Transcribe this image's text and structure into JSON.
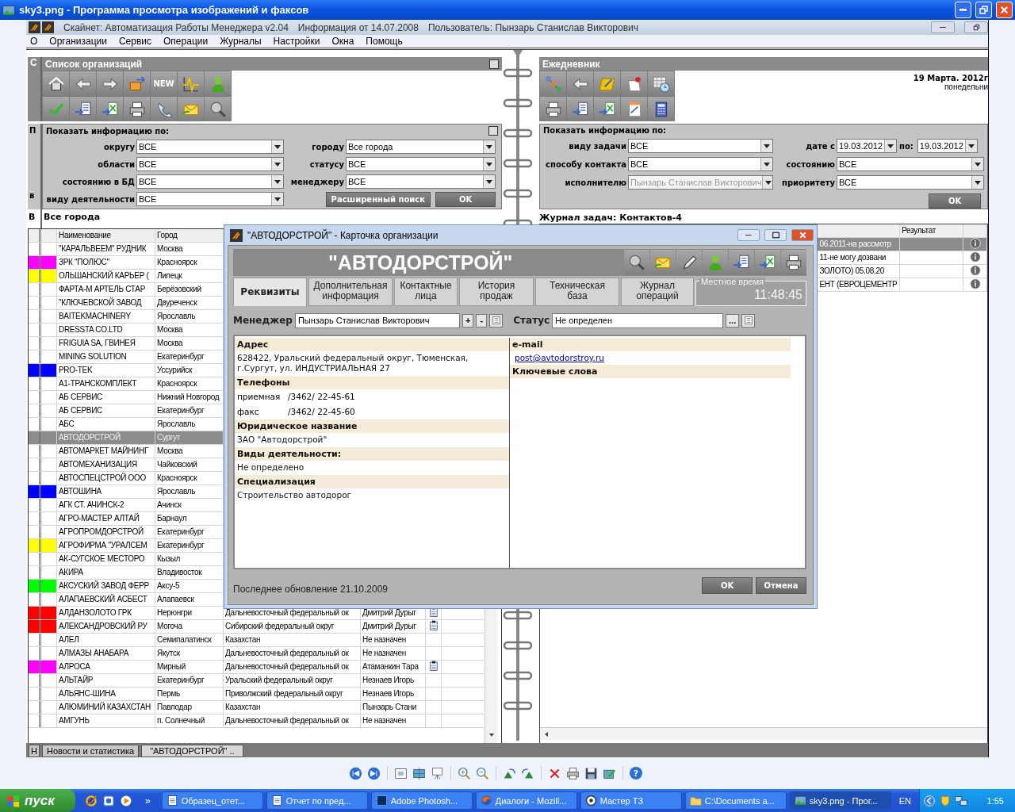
{
  "window": {
    "title": "sky3.png - Программа просмотра изображений и факсов"
  },
  "app": {
    "title": "Скайнет: Автоматизация Работы Менеджера  v2.04",
    "info": "Информация от 14.07.2008",
    "user": "Пользователь: Пынзарь Станислав Викторович"
  },
  "menu": [
    "О",
    "Организации",
    "Сервис",
    "Операции",
    "Журналы",
    "Настройки",
    "Окна",
    "Помощь"
  ],
  "background_window": {
    "title": "С",
    "filter": "П",
    "field": "в",
    "caption": "В",
    "tab": "Н"
  },
  "org_list": {
    "title": "Список организаций",
    "new_button": "NEW",
    "filter": {
      "heading": "Показать информацию по:",
      "left": [
        {
          "label": "округу",
          "value": "ВСЕ"
        },
        {
          "label": "области",
          "value": "ВСЕ"
        },
        {
          "label": "состоянию в БД",
          "value": "ВСЕ"
        },
        {
          "label": "виду деятельности",
          "value": "ВСЕ"
        }
      ],
      "right": [
        {
          "label": "городу",
          "value": "Все города"
        },
        {
          "label": "статусу",
          "value": "ВСЕ"
        },
        {
          "label": "менеджеру",
          "value": "ВСЕ"
        }
      ],
      "buttons": [
        "Расширенный поиск",
        "OK"
      ]
    },
    "caption": "Все города",
    "columns": [
      "Наименование",
      "Город"
    ],
    "rows": [
      {
        "name": "\"КАРАЛЬВЕЕМ\" РУДНИК",
        "city": "Москва",
        "note": false,
        "selected": false
      },
      {
        "name": "ЗРК \"ПОЛЮС\"",
        "city": "Красноярск",
        "note": false,
        "selected": false,
        "color": "#ff00ff"
      },
      {
        "name": "ОЛЬШАНСКИЙ КАРЬЕР (",
        "city": "Липецк",
        "note": false,
        "selected": false,
        "color": "#ffff00"
      },
      {
        "name": "ФАРТА-М АРТЕЛЬ СТАР",
        "city": "Берёзовский",
        "note": false,
        "selected": false
      },
      {
        "name": "\"КЛЮЧЕВСКОЙ ЗАВОД",
        "city": "Двуреченск",
        "note": false,
        "selected": false
      },
      {
        "name": "BAITEKMACHINERY",
        "city": "Ярославль",
        "note": false,
        "selected": false
      },
      {
        "name": "DRESSTA CO.LTD",
        "city": "Москва",
        "note": false,
        "selected": false
      },
      {
        "name": "FRIGUIA SA, ГВИНЕЯ",
        "city": "Москва",
        "note": false,
        "selected": false
      },
      {
        "name": "MINING SOLUTION",
        "city": "Екатеринбург",
        "note": false,
        "selected": false
      },
      {
        "name": "PRO-TEK",
        "city": "Уссурийск",
        "note": false,
        "selected": false,
        "color": "#0000ff"
      },
      {
        "name": "А1-ТРАНСКОМПЛЕКТ",
        "city": "Красноярск",
        "note": false,
        "selected": false
      },
      {
        "name": "АБ СЕРВИС",
        "city": "Нижний Новгород",
        "note": false,
        "selected": false
      },
      {
        "name": "АБ СЕРВИС",
        "city": "Екатеринбург",
        "note": false,
        "selected": false
      },
      {
        "name": "АБС",
        "city": "Ярославль",
        "note": false,
        "selected": false
      },
      {
        "name": "АВТОДОРСТРОЙ",
        "city": "Сургут",
        "note": false,
        "selected": true
      },
      {
        "name": "АВТОМАРКЕТ МАЙНИНГ",
        "city": "Москва",
        "note": false,
        "selected": false
      },
      {
        "name": "АВТОМЕХАНИЗАЦИЯ",
        "city": "Чайковский",
        "note": false,
        "selected": false
      },
      {
        "name": "АВТОСПЕЦСТРОЙ ООО",
        "city": "Красноярск",
        "note": false,
        "selected": false
      },
      {
        "name": "АВТОШИНА",
        "city": "Ярославль",
        "note": false,
        "selected": false,
        "color": "#0000ff"
      },
      {
        "name": "АГК СТ. АЧИНСК-2",
        "city": "Ачинск",
        "note": false,
        "selected": false
      },
      {
        "name": "АГРО-МАСТЕР АЛТАЙ",
        "city": "Барнаул",
        "note": false,
        "selected": false
      },
      {
        "name": "АГРОПРОМДОРСТРОЙ",
        "city": "Екатеринбург",
        "note": false,
        "selected": false
      },
      {
        "name": "АГРОФИРМА \"УРАЛСЕМ",
        "city": "Екатеринбург",
        "note": false,
        "selected": false,
        "color": "#ffff00"
      },
      {
        "name": "АК-СУГСКОЕ МЕСТОРО",
        "city": "Кызыл",
        "note": false,
        "selected": false
      },
      {
        "name": "АКИРА",
        "city": "Владивосток",
        "note": false,
        "selected": false
      },
      {
        "name": "АКСУСКИЙ ЗАВОД ФЕРР",
        "city": "Аксу-5",
        "note": false,
        "selected": false,
        "color": "#00ff00"
      },
      {
        "name": "АЛАПАЕВСКИЙ АСБЕСТ",
        "city": "Алапаевск",
        "note": false,
        "selected": false
      },
      {
        "name": "АЛДАНЗОЛОТО ГРК",
        "city": "Нерюнгри",
        "district": "Дальневосточный федеральный ок",
        "manager": "Дмитрий Дурыг",
        "note": true,
        "selected": false,
        "color": "#ff0000"
      },
      {
        "name": "АЛЕКСАНДРОВСКИЙ РУ",
        "city": "Могоча",
        "district": "Сибирский федеральный округ",
        "manager": "Дмитрий Дурыг",
        "note": true,
        "selected": false,
        "color": "#ff0000"
      },
      {
        "name": "АЛЕЛ",
        "city": "Семипалатинск",
        "district": "Казахстан",
        "manager": "Не назначен",
        "note": false,
        "selected": false
      },
      {
        "name": "АЛМАЗЫ АНАБАРА",
        "city": "Якутск",
        "district": "Дальневосточный федеральный ок",
        "manager": "Не назначен",
        "note": false,
        "selected": false
      },
      {
        "name": "АЛРОСА",
        "city": "Мирный",
        "district": "Дальневосточный федеральный ок",
        "manager": "Атаманкин Тара",
        "note": true,
        "selected": false,
        "color": "#ff00ff"
      },
      {
        "name": "АЛЬТАЙР",
        "city": "Екатеринбург",
        "district": "Уральский федеральный округ",
        "manager": "Незнаев Игорь",
        "note": false,
        "selected": false
      },
      {
        "name": "АЛЬЯНС-ШИНА",
        "city": "Пермь",
        "district": "Приволжский федеральный округ",
        "manager": "Незнаев Игорь",
        "note": false,
        "selected": false
      },
      {
        "name": "АЛЮМИНИЙ КАЗАХСТАН",
        "city": "Павлодар",
        "district": "Казахстан",
        "manager": "Пынзарь Стани",
        "note": false,
        "selected": false
      },
      {
        "name": "АМГУНЬ",
        "city": "п. Солнечный",
        "district": "Дальневосточный федеральный ок",
        "manager": "Не назначен",
        "note": false,
        "selected": false
      }
    ]
  },
  "diary": {
    "title": "Ежедневник",
    "date": "19 Марта.  2012г",
    "weekday": "понедельни",
    "filter": {
      "heading": "Показать информацию по:",
      "left": [
        {
          "label": "виду задачи",
          "value": "ВСЕ",
          "disabled": false
        },
        {
          "label": "способу контакта",
          "value": "ВСЕ",
          "disabled": false
        },
        {
          "label": "исполнителю",
          "value": "Пынзарь Станислав Викторович",
          "disabled": true
        }
      ],
      "right": [
        {
          "label": "дате с",
          "value": "19.03.2012",
          "to_label": "по:",
          "to_value": "19.03.2012"
        },
        {
          "label": "состоянию",
          "value": "ВСЕ"
        },
        {
          "label": "приоритету",
          "value": "ВСЕ"
        }
      ],
      "button": "OK"
    },
    "journal_title": "Журнал задач: Контактов-4",
    "columns": [
      "Результат"
    ],
    "rows": [
      {
        "text": "06.2011-на рассмотр",
        "selected": true
      },
      {
        "text": "11-не могу дозвани",
        "selected": false
      },
      {
        "text": "ЗОЛОТО)  05.08.20",
        "selected": false
      },
      {
        "text": "ЕНТ (ЕВРОЦЕМЕНТР",
        "selected": false
      }
    ]
  },
  "card": {
    "title": "\"АВТОДОРСТРОЙ\" - Карточка организации",
    "heading": "\"АВТОДОРСТРОЙ\"",
    "tabs": [
      {
        "label": "Реквизиты",
        "selected": true
      },
      {
        "label": "Дополнительная\nинформация",
        "selected": false
      },
      {
        "label": "Контактные\nлица",
        "selected": false
      },
      {
        "label": "История\nпродаж",
        "selected": false
      },
      {
        "label": "Техническая\nбаза",
        "selected": false
      },
      {
        "label": "Журнал\nопераций",
        "selected": false
      }
    ],
    "local_time": {
      "label": "Местное время",
      "value": "11:48:45"
    },
    "manager": {
      "label": "Менеджер",
      "value": "Пынзарь Станислав Викторович",
      "buttons": [
        "+",
        "-"
      ]
    },
    "status": {
      "label": "Статус",
      "value": "Не определен",
      "button": "..."
    },
    "left": [
      {
        "heading": "Адрес",
        "kind": "text",
        "lines": [
          "628422, Уральский федеральный округ, Тюменская,\nг.Сургут, ул. ИНДУСТРИАЛЬНАЯ 27"
        ]
      },
      {
        "heading": "Телефоны",
        "kind": "phones",
        "phones": [
          {
            "label": "приемная",
            "number": "/3462/ 22-45-61"
          },
          {
            "label": "факс",
            "number": "/3462/ 22-45-60"
          }
        ]
      },
      {
        "heading": "Юридическое название",
        "kind": "text",
        "lines": [
          "ЗАО \"Автодорстрой\""
        ]
      },
      {
        "heading": "Виды деятельности:",
        "kind": "text",
        "lines": [
          "Не определено"
        ]
      },
      {
        "heading": "Специализация",
        "kind": "text",
        "lines": [
          "Строительство автодорог"
        ]
      }
    ],
    "right": [
      {
        "heading": "e-mail",
        "kind": "link",
        "lines": [
          "post@avtodorstroy.ru"
        ]
      },
      {
        "heading": "Ключевые слова",
        "kind": "text"
      }
    ],
    "updated": "Последнее обновление 21.10.2009",
    "buttons": [
      "OK",
      "Отмена"
    ]
  },
  "mdi_tabs": [
    {
      "label": "Новости и статистика",
      "selected": false
    },
    {
      "label": "\"АВТОДОРСТРОЙ\" ..",
      "selected": true
    }
  ],
  "viewer_toolbar": {
    "help": "?"
  },
  "taskbar": {
    "start": "пуск",
    "more": "»",
    "tasks": [
      {
        "label": "Образец_отет...",
        "selected": false
      },
      {
        "label": "Отчет по пред...",
        "selected": false
      },
      {
        "label": "Adobe Photosh...",
        "selected": false
      },
      {
        "label": "Диалоги - Mozill...",
        "selected": false
      },
      {
        "label": "Мастер ТЗ",
        "selected": false
      },
      {
        "label": "C:\\Documents a...",
        "selected": false
      },
      {
        "label": "sky3.png - Прог...",
        "selected": true
      }
    ],
    "language": "EN",
    "clock": "1:55"
  }
}
